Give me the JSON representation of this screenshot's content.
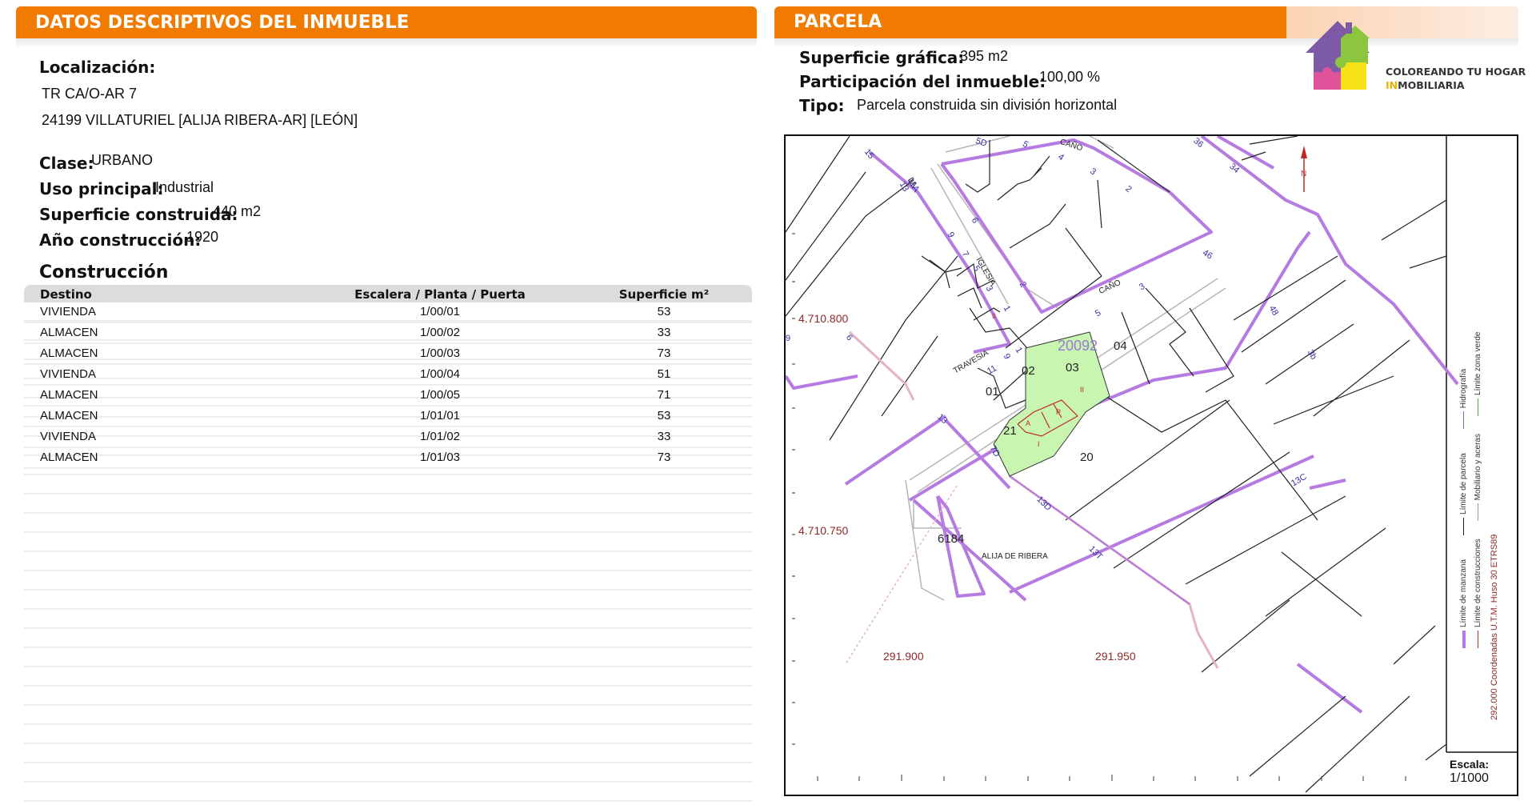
{
  "left_panel": {
    "title_part1": "DATOS DESCRIPTIVOS DEL ",
    "title_part2": "INMUEBLE",
    "localizacion_label": "Localización:",
    "address_line1": "TR CA/O-AR 7",
    "address_line2": "24199 VILLATURIEL [ALIJA RIBERA-AR] [LEÓN]",
    "clase_label": "Clase:",
    "clase_value": "URBANO",
    "uso_label": "Uso principal:",
    "uso_value": "Industrial",
    "superficie_label": "Superficie construida:",
    "superficie_value": "440 m2",
    "anio_label": "Año construcción:",
    "anio_value": "1920",
    "construccion_title": "Construcción",
    "table": {
      "headers": [
        "Destino",
        "Escalera / Planta / Puerta",
        "Superficie m²"
      ],
      "rows": [
        [
          "VIVIENDA",
          "1/00/01",
          "53"
        ],
        [
          "ALMACEN",
          "1/00/02",
          "33"
        ],
        [
          "ALMACEN",
          "1/00/03",
          "73"
        ],
        [
          "VIVIENDA",
          "1/00/04",
          "51"
        ],
        [
          "ALMACEN",
          "1/00/05",
          "71"
        ],
        [
          "ALMACEN",
          "1/01/01",
          "53"
        ],
        [
          "VIVIENDA",
          "1/01/02",
          "33"
        ],
        [
          "ALMACEN",
          "1/01/03",
          "73"
        ]
      ]
    }
  },
  "right_panel": {
    "title": "PARCELA",
    "sup_grafica_label": "Superficie gráfica:",
    "sup_grafica_value": "395 m2",
    "participacion_label": "Participación del inmueble:",
    "participacion_value": "100,00 %",
    "tipo_label": "Tipo:",
    "tipo_value": "Parcela construida sin división horizontal"
  },
  "logo": {
    "line1": "COLOREANDO TU HOGAR",
    "line2_accent": "IN",
    "line2_rest": "MOBILIARIA",
    "colors": {
      "purple": "#7d5aa6",
      "green": "#8cc63f",
      "pink": "#e0539a",
      "yellow": "#f7e21a"
    }
  },
  "map": {
    "parcel_ref": "20092",
    "lot_labels": [
      "04",
      "03",
      "02",
      "01",
      "21",
      "20",
      "6184"
    ],
    "street_labels": [
      "CAÑO",
      "CAÑO",
      "IGLESIA",
      "TRAVESIA",
      "LA"
    ],
    "place_label": "ALIJA DE RIBERA",
    "house_numbers": [
      "5D",
      "5",
      "4",
      "3",
      "2",
      "9",
      "7",
      "5",
      "3",
      "1",
      "6",
      "2",
      "15",
      "13",
      "11A",
      "46",
      "3",
      "5",
      "48",
      "36",
      "34",
      "9",
      "11",
      "1",
      "13",
      "7D",
      "13D",
      "13T",
      "13C",
      "6",
      "9",
      "3b"
    ],
    "coords": {
      "y_top": "4.710.800",
      "y_bottom": "4.710.750",
      "x_left": "291.900",
      "x_right": "291.950"
    },
    "legend": {
      "col1": [
        "Límite de manzana",
        "Límite de parcela",
        "Hidrografía"
      ],
      "col2": [
        "Límite de construcciones",
        "Mobiliario y aceras",
        "Límite zona verde"
      ],
      "crs": "292.000 Coordenadas U.T.M. Huso 30 ETRS89"
    },
    "scale_label": "Escala:",
    "scale_value": "1/1000",
    "colors": {
      "parcel_fill": "#c8f5b0",
      "block_line": "#b57be0",
      "parcel_pink": "#e6b3c4",
      "coord_text": "#8b2a2a"
    }
  }
}
